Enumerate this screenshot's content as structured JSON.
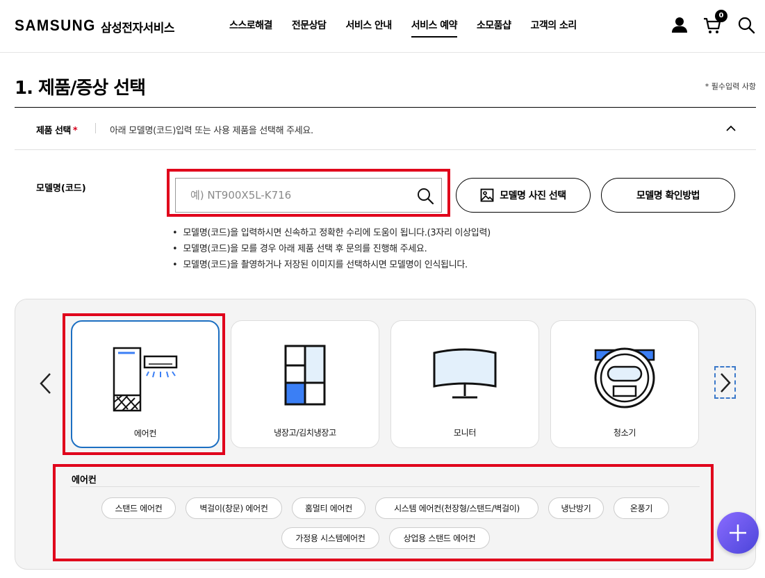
{
  "header": {
    "logo": "SAMSUNG",
    "logo_sub": "삼성전자서비스",
    "nav": [
      "스스로해결",
      "전문상담",
      "서비스 안내",
      "서비스 예약",
      "소모품샵",
      "고객의 소리"
    ],
    "active_nav": "서비스 예약",
    "cart_count": "0",
    "icons": [
      "user-icon",
      "cart-icon",
      "search-icon"
    ]
  },
  "page": {
    "title": "1. 제품/증상 선택",
    "required_note": "* 필수입력 사항"
  },
  "product_select": {
    "label": "제품 선택",
    "star": "*",
    "description": "아래 모델명(코드)입력 또는 사용 제품을 선택해 주세요."
  },
  "model": {
    "label": "모델명(코드)",
    "placeholder": "예) NT900X5L-K716",
    "photo_button": "모델명 사진 선택",
    "howto_button": "모델명 확인방법",
    "tips": [
      "모델명(코드)을 입력하시면 신속하고 정확한 수리에 도움이 됩니다.(3자리 이상입력)",
      "모델명(코드)을 모를 경우 아래 제품 선택 후 문의를 진행해 주세요.",
      "모델명(코드)을 촬영하거나 저장된 이미지를 선택하시면 모델명이 인식됩니다."
    ]
  },
  "categories": {
    "items": [
      {
        "label": "에어컨",
        "icon": "air-conditioner-icon"
      },
      {
        "label": "냉장고/김치냉장고",
        "icon": "refrigerator-icon"
      },
      {
        "label": "모니터",
        "icon": "monitor-icon"
      },
      {
        "label": "청소기",
        "icon": "robot-vacuum-icon"
      }
    ],
    "selected": "에어컨"
  },
  "subcategories": {
    "title": "에어컨",
    "chips": [
      "스탠드 에어컨",
      "벽걸이(창문) 에어컨",
      "홈멀티 에어컨",
      "시스템 에어컨(천장형/스탠드/벽걸이)",
      "냉난방기",
      "온풍기",
      "가정용 시스템에어컨",
      "상업용 스탠드 에어컨"
    ]
  },
  "colors": {
    "highlight": "#e0001b",
    "selected_border": "#1c6fc2",
    "accent_blue": "#3b7ff5",
    "fab": "#6a57f0"
  }
}
